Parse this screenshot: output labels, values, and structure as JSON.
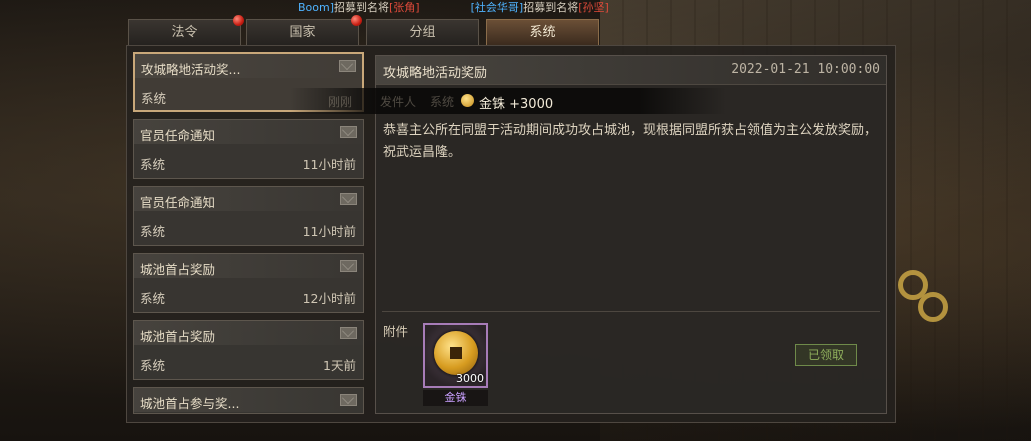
{
  "marquee": {
    "p1_name": "Boom]",
    "p1_text": "招募到名将",
    "p1_general": "[张角]",
    "p2_name": "[社会华哥]",
    "p2_text": "招募到名将",
    "p2_general": "[孙坚]"
  },
  "tabs": [
    {
      "label": "法令",
      "badge": true,
      "active": false
    },
    {
      "label": "国家",
      "badge": true,
      "active": false
    },
    {
      "label": "分组",
      "badge": false,
      "active": false
    },
    {
      "label": "系统",
      "badge": false,
      "active": true
    }
  ],
  "mail_list": [
    {
      "title": "攻城略地活动奖...",
      "sender": "系统",
      "time": "",
      "selected": true
    },
    {
      "title": "官员任命通知",
      "sender": "系统",
      "time": "11小时前"
    },
    {
      "title": "官员任命通知",
      "sender": "系统",
      "time": "11小时前"
    },
    {
      "title": "城池首占奖励",
      "sender": "系统",
      "time": "12小时前"
    },
    {
      "title": "城池首占奖励",
      "sender": "系统",
      "time": "1天前"
    },
    {
      "title": "城池首占参与奖...",
      "sender": "",
      "time": ""
    }
  ],
  "detail": {
    "title": "攻城略地活动奖励",
    "date": "2022-01-21 10:00:00",
    "body": "恭喜主公所在同盟于活动期间成功攻占城池，现根据同盟所获占领值为主公发放奖励，祝武运昌隆。",
    "attach_label": "附件",
    "attachment": {
      "name": "金铢",
      "qty": "3000"
    },
    "claimed_label": "已领取"
  },
  "tooltip": {
    "ghost_1": "刚刚",
    "ghost_2": "发件人",
    "ghost_3": "系统",
    "text": "金铢 +3000"
  },
  "colors": {
    "accent_gold": "#c9a87a",
    "marquee_blue": "#4fb3ff",
    "marquee_red": "#e04a3a",
    "claimed_green": "#8fae5c",
    "item_purple": "#c9a0ff"
  }
}
